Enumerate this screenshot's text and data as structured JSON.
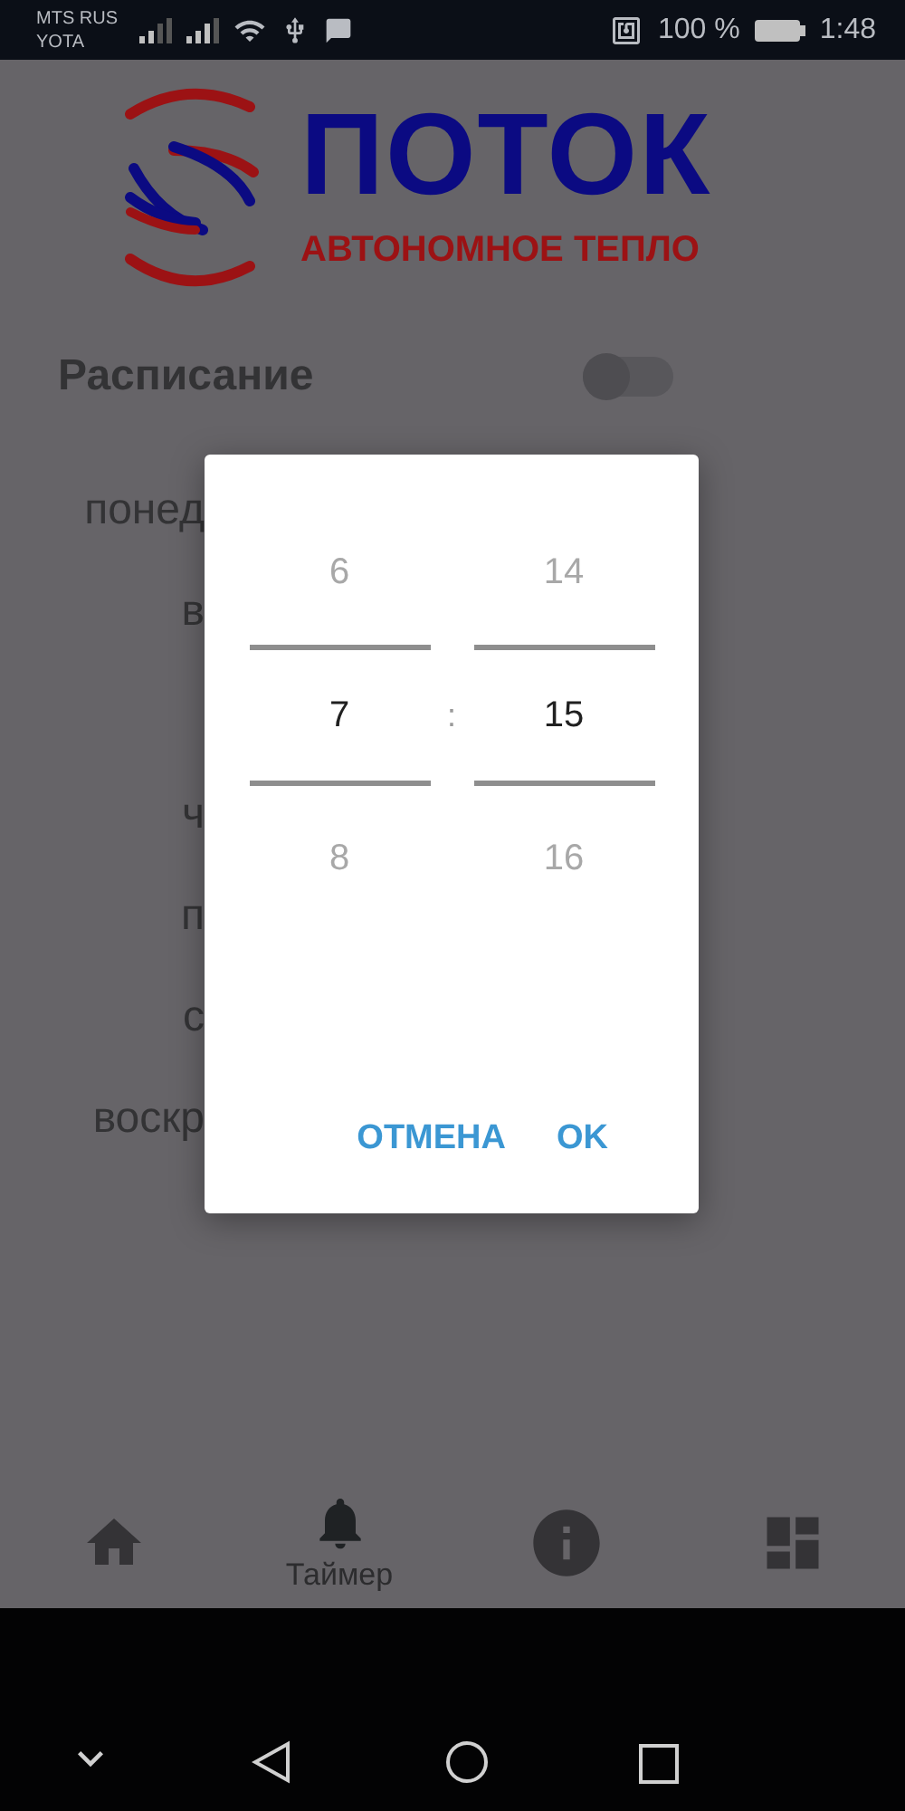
{
  "status_bar": {
    "carriers": [
      "MTS RUS",
      "YOTA"
    ],
    "battery": "100 %",
    "time": "1:48"
  },
  "logo": {
    "title": "ПОТОК",
    "subtitle": "АВТОНОМНОЕ ТЕПЛО"
  },
  "schedule": {
    "label": "Расписание",
    "on": false
  },
  "days": [
    {
      "label": "понед"
    },
    {
      "label": "в"
    },
    {
      "label": "ч"
    },
    {
      "label": "п"
    },
    {
      "label": "с"
    },
    {
      "label": "воскр"
    }
  ],
  "time_picker": {
    "columns": [
      {
        "values": [
          {
            "text": "6",
            "selected": false
          },
          {
            "text": "7",
            "selected": true
          },
          {
            "text": "8",
            "selected": false
          }
        ]
      },
      {
        "values": [
          {
            "text": "14",
            "selected": false
          },
          {
            "text": "15",
            "selected": true
          },
          {
            "text": "16",
            "selected": false
          }
        ]
      }
    ],
    "separator": ":",
    "buttons": [
      "ОТМЕНА",
      "OK"
    ]
  },
  "bottom_nav": [
    {
      "kind": "home",
      "selected": false
    },
    {
      "kind": "timer",
      "label": "Таймер",
      "selected": true
    },
    {
      "kind": "info",
      "selected": false
    },
    {
      "kind": "dashboard",
      "selected": false
    }
  ]
}
